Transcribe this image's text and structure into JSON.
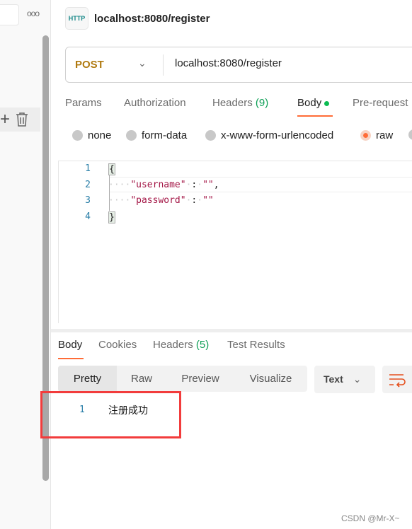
{
  "sidebar": {
    "more_label": "ooo"
  },
  "header": {
    "icon_label": "HTTP",
    "title": "localhost:8080/register"
  },
  "request": {
    "method": "POST",
    "url": "localhost:8080/register"
  },
  "tabs": [
    {
      "label": "Params"
    },
    {
      "label": "Authorization"
    },
    {
      "label": "Headers",
      "count": "(9)"
    },
    {
      "label": "Body"
    },
    {
      "label": "Pre-request"
    }
  ],
  "body_types": [
    {
      "label": "none"
    },
    {
      "label": "form-data"
    },
    {
      "label": "x-www-form-urlencoded"
    },
    {
      "label": "raw",
      "selected": true
    }
  ],
  "editor": {
    "lines": [
      "1",
      "2",
      "3",
      "4"
    ],
    "open": "{",
    "k1": "\"username\"",
    "v1": "\"\"",
    "k2": "\"password\"",
    "v2": "\"\"",
    "close": "}"
  },
  "response": {
    "tabs": [
      {
        "label": "Body"
      },
      {
        "label": "Cookies"
      },
      {
        "label": "Headers",
        "count": "(5)"
      },
      {
        "label": "Test Results"
      }
    ],
    "views": [
      "Pretty",
      "Raw",
      "Preview",
      "Visualize"
    ],
    "format": "Text",
    "line": "1",
    "text": "注册成功"
  },
  "colors": {
    "accent": "#ff6c37",
    "method": "#b07a10",
    "highlight_box": "#f23c3c"
  },
  "watermark": "CSDN @Mr-X~"
}
